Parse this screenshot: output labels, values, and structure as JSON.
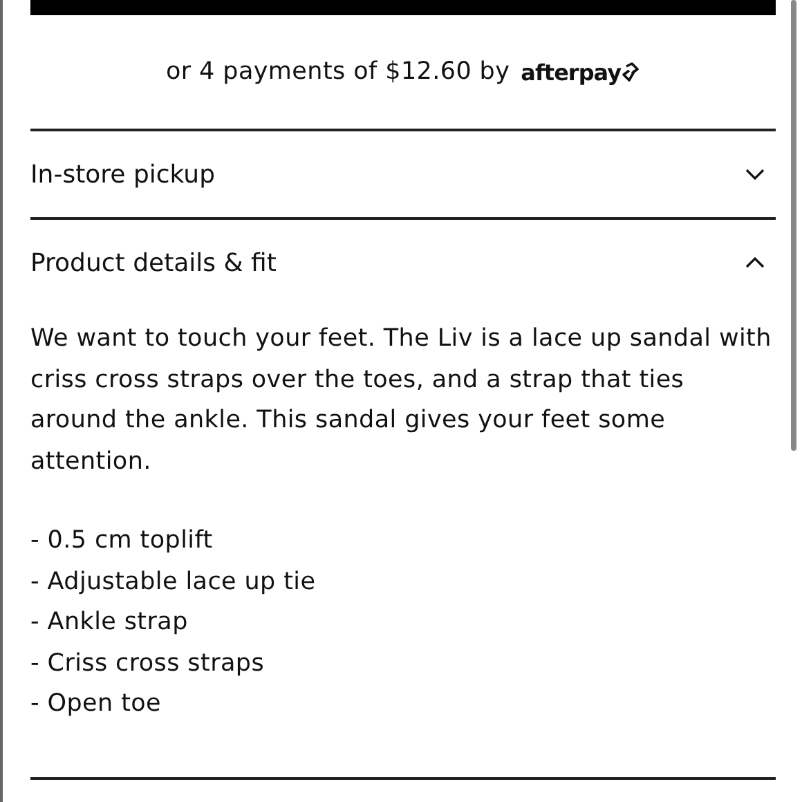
{
  "payment": {
    "text": "or 4 payments of $12.60 by",
    "brand": "afterpay"
  },
  "sections": [
    {
      "title": "In-store pickup",
      "expanded": false
    },
    {
      "title": "Product details & fit",
      "expanded": true,
      "description": "We want to touch your feet. The Liv is a lace up sandal with criss cross straps over the toes, and a strap that ties around the ankle. This sandal gives your feet some attention.",
      "features": [
        "- 0.5 cm toplift",
        "- Adjustable lace up tie",
        "- Ankle strap",
        "- Criss cross straps",
        "- Open toe"
      ]
    }
  ]
}
